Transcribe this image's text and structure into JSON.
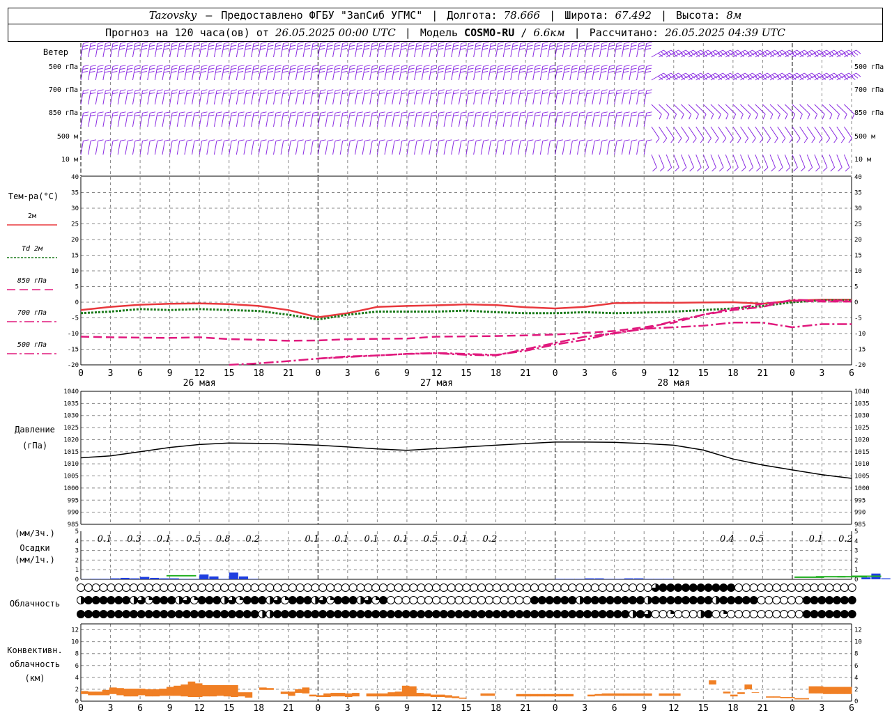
{
  "header": {
    "station": "Tazovsky",
    "source": "Предоставлено ФГБУ \"ЗапСиб УГМС\"",
    "lon_label": "Долгота:",
    "lon_value": "78.666",
    "lat_label": "Широта:",
    "lat_value": "67.492",
    "alt_label": "Высота:",
    "alt_value": "8м",
    "forecast_prefix": "Прогноз на 120 часа(ов) от",
    "forecast_start": "26.05.2025 00:00 UTC",
    "model_label": "Модель",
    "model_name": "COSMO-RU",
    "model_res": "6.6км",
    "computed_label": "Рассчитано:",
    "computed_value": "26.05.2025 04:39 UTC"
  },
  "colors": {
    "wind": "#8a2be2",
    "t2m": "#e8383d",
    "td2m": "#1a7a1a",
    "t850": "#e0197d",
    "t700": "#e0197d",
    "t500": "#e0197d",
    "pressure": "#000000",
    "precip_rain": "#1f3fe0",
    "precip_mixed": "#22b022",
    "convective": "#f07f24",
    "grid": "#888888"
  },
  "wind_panel": {
    "title": "Ветер",
    "levels": [
      "500 гПа",
      "700 гПа",
      "850 гПа",
      "500 м",
      "10 м"
    ]
  },
  "time_axis": {
    "hour_labels": [
      "0",
      "3",
      "6",
      "9",
      "12",
      "15",
      "18",
      "21",
      "0",
      "3",
      "6",
      "9",
      "12",
      "15",
      "18",
      "21",
      "0",
      "3",
      "6",
      "9",
      "12",
      "15",
      "18",
      "21",
      "0",
      "3",
      "6"
    ],
    "day_labels": [
      "26 мая",
      "27 мая",
      "28 мая"
    ]
  },
  "chart_data": [
    {
      "type": "line",
      "ylabel": "Тем-ра(°C)",
      "ylim": [
        -20,
        40
      ],
      "yticks": [
        "40",
        "35",
        "30",
        "25",
        "20",
        "15",
        "10",
        "5",
        "0",
        "-5",
        "-10",
        "-15",
        "-20"
      ],
      "x_hours_step": 3,
      "series": [
        {
          "name": "2м",
          "style": "solid",
          "values": [
            -2.5,
            -1.5,
            -0.8,
            -0.5,
            -0.4,
            -0.6,
            -1.2,
            -2.5,
            -4.8,
            -3.5,
            -1.5,
            -1.2,
            -1.0,
            -0.7,
            -0.9,
            -1.6,
            -2.0,
            -1.5,
            -0.3,
            -0.2,
            -0.2,
            -0.1,
            0.0,
            -0.5,
            0.5,
            0.8,
            0.8
          ]
        },
        {
          "name": "Td 2м",
          "style": "dotted",
          "values": [
            -3.5,
            -3.0,
            -2.2,
            -2.5,
            -2.2,
            -2.5,
            -2.8,
            -4.0,
            -5.5,
            -4.0,
            -3.0,
            -3.0,
            -3.0,
            -2.7,
            -3.2,
            -3.5,
            -3.5,
            -3.2,
            -3.5,
            -3.3,
            -3.0,
            -2.5,
            -2.0,
            -1.2,
            0.0,
            0.6,
            0.6
          ]
        },
        {
          "name": "850 гПа",
          "style": "dashed",
          "values": [
            -11.0,
            -11.2,
            -11.3,
            -11.4,
            -11.2,
            -11.8,
            -12.0,
            -12.3,
            -12.2,
            -11.8,
            -11.7,
            -11.6,
            -11.0,
            -10.9,
            -10.8,
            -10.6,
            -10.3,
            -9.8,
            -9.2,
            -8.0,
            -6.5,
            -4.0,
            -2.0,
            -0.5,
            0.5,
            0.2,
            0.2
          ]
        },
        {
          "name": "700 гПа",
          "style": "dashdot",
          "values": [
            null,
            null,
            null,
            null,
            null,
            null,
            null,
            null,
            -18.0,
            -17.3,
            -17.0,
            -16.5,
            -16.3,
            -16.8,
            -17.0,
            -15.0,
            -13.0,
            -11.0,
            -10.0,
            -8.5,
            -8.0,
            -7.5,
            -6.5,
            -6.5,
            -8.0,
            -7.0,
            -7.0
          ]
        },
        {
          "name": "500 гПа",
          "style": "dashdot",
          "values": [
            null,
            null,
            null,
            null,
            null,
            -20.0,
            -19.5,
            -18.8,
            -18.0,
            -17.5,
            -17.0,
            -16.5,
            -16.2,
            -16.5,
            -16.8,
            -15.5,
            -13.5,
            -12.0,
            -9.8,
            -8.5,
            -6.0,
            -4.0,
            -2.5,
            -1.5,
            0.8,
            0.5,
            0.5
          ]
        }
      ]
    },
    {
      "type": "line",
      "ylabel": "Давление",
      "yunit": "(гПа)",
      "ylim": [
        985,
        1040
      ],
      "yticks": [
        "1040",
        "1035",
        "1030",
        "1025",
        "1020",
        "1015",
        "1010",
        "1005",
        "1000",
        "995",
        "990",
        "985"
      ],
      "series": [
        {
          "name": "Давление",
          "values": [
            1012.5,
            1013.3,
            1015.0,
            1016.8,
            1018.0,
            1018.6,
            1018.5,
            1018.2,
            1017.7,
            1017.0,
            1016.2,
            1015.6,
            1016.3,
            1017.0,
            1017.7,
            1018.4,
            1019.0,
            1019.0,
            1018.9,
            1018.4,
            1017.7,
            1015.7,
            1012.0,
            1009.5,
            1007.5,
            1005.5,
            1004.0
          ]
        }
      ]
    },
    {
      "type": "bar",
      "ylabel": "Осадки",
      "yunit_top": "(мм/3ч.)",
      "yunit_bottom": "(мм/1ч.)",
      "ylim": [
        0,
        5
      ],
      "yticks": [
        "5",
        "4",
        "3",
        "2",
        "1",
        "0"
      ],
      "totals_3h": [
        {
          "hour_index": 0.3,
          "value": "0.1"
        },
        {
          "hour_index": 1.3,
          "value": "0.3"
        },
        {
          "hour_index": 2.3,
          "value": "0.1"
        },
        {
          "hour_index": 3.3,
          "value": "0.5"
        },
        {
          "hour_index": 4.3,
          "value": "0.8"
        },
        {
          "hour_index": 5.3,
          "value": "0.2"
        },
        {
          "hour_index": 7.3,
          "value": "0.1"
        },
        {
          "hour_index": 8.3,
          "value": "0.1"
        },
        {
          "hour_index": 9.3,
          "value": "0.1"
        },
        {
          "hour_index": 10.3,
          "value": "0.1"
        },
        {
          "hour_index": 11.3,
          "value": "0.5"
        },
        {
          "hour_index": 12.3,
          "value": "0.1"
        },
        {
          "hour_index": 13.3,
          "value": "0.2"
        },
        {
          "hour_index": 21.3,
          "value": "0.4"
        },
        {
          "hour_index": 22.3,
          "value": "0.5"
        },
        {
          "hour_index": 24.3,
          "value": "0.1"
        },
        {
          "hour_index": 25.3,
          "value": "0.2"
        }
      ],
      "hourly_mm": [
        0.02,
        0.05,
        0.05,
        0.1,
        0.15,
        0.1,
        0.25,
        0.15,
        0.1,
        0.1,
        0.05,
        0.05,
        0.5,
        0.3,
        0.05,
        0.7,
        0.3,
        0.05,
        0.0,
        0.0,
        0.0,
        0.0,
        0.0,
        0.0,
        0.05,
        0.05,
        0.05,
        0.1,
        0.1,
        0.05,
        0.05,
        0.1,
        0.1,
        0.05,
        0.05,
        0.05,
        0.0,
        0.2,
        0.6,
        0.1,
        0.05,
        0.0,
        0.05,
        0.1,
        0.1,
        0.05,
        0.0,
        0.0
      ],
      "mixed_bars": [
        {
          "hour": 12,
          "value": 0.3
        },
        {
          "hour": 100,
          "value": 0.15
        },
        {
          "hour": 103,
          "value": 0.2
        },
        {
          "hour": 106,
          "value": 0.2
        },
        {
          "hour": 108,
          "value": 0.25
        }
      ]
    },
    {
      "type": "table",
      "ylabel": "Облачность",
      "rows": [
        "000000000000000000000000000000000000000000000000000000000000000000000000000000000000000000000000000000000000000000000000",
        "244444434442444244424222224444424432100000000000000000000000000000002442444444444444444444440000444444",
        "444444444444444444444444444444444444444444444444444444444444444444444424444432400000000002400000444444444444"
      ],
      "row_top_special": {
        "cols": [
          76,
          77,
          78,
          79,
          80,
          81,
          82,
          83,
          84,
          85,
          86
        ],
        "values": [
          3,
          4,
          4,
          4,
          4,
          4,
          4,
          4,
          4,
          4,
          4
        ],
        "start": 76
      }
    },
    {
      "type": "bar",
      "ylabel": "Конвективн. облачность (км)",
      "ylim": [
        0,
        13
      ],
      "yticks": [
        "12",
        "10",
        "8",
        "6",
        "4",
        "2",
        "0"
      ],
      "ranges_km": [
        [
          1.2,
          1.7
        ],
        [
          1.0,
          1.6
        ],
        [
          1.0,
          1.6
        ],
        [
          1.0,
          1.9
        ],
        [
          1.2,
          2.3
        ],
        [
          1.0,
          2.2
        ],
        [
          0.8,
          2.1
        ],
        [
          0.8,
          2.1
        ],
        [
          1.0,
          2.1
        ],
        [
          0.8,
          2.0
        ],
        [
          0.8,
          2.0
        ],
        [
          0.9,
          2.1
        ],
        [
          0.9,
          2.4
        ],
        [
          0.9,
          2.6
        ],
        [
          0.8,
          2.8
        ],
        [
          0.7,
          3.3
        ],
        [
          0.7,
          3.0
        ],
        [
          0.8,
          2.7
        ],
        [
          0.8,
          2.7
        ],
        [
          0.9,
          2.7
        ],
        [
          0.8,
          2.7
        ],
        [
          0.7,
          2.7
        ],
        [
          0.8,
          1.5
        ],
        [
          0.6,
          1.5
        ],
        [
          null,
          null
        ],
        [
          1.9,
          2.3
        ],
        [
          1.9,
          2.2
        ],
        [
          null,
          null
        ],
        [
          1.2,
          1.6
        ],
        [
          0.9,
          1.6
        ],
        [
          1.4,
          2.0
        ],
        [
          1.3,
          2.3
        ],
        [
          0.8,
          1.1
        ],
        [
          0.7,
          1.0
        ],
        [
          0.7,
          1.3
        ],
        [
          0.8,
          1.4
        ],
        [
          0.8,
          1.4
        ],
        [
          0.7,
          1.3
        ],
        [
          0.8,
          1.4
        ],
        [
          null,
          null
        ],
        [
          0.8,
          1.3
        ],
        [
          0.8,
          1.3
        ],
        [
          0.8,
          1.3
        ],
        [
          0.8,
          1.5
        ],
        [
          0.8,
          1.6
        ],
        [
          0.8,
          2.6
        ],
        [
          0.8,
          2.5
        ],
        [
          0.8,
          1.4
        ],
        [
          0.8,
          1.3
        ],
        [
          0.7,
          1.1
        ],
        [
          0.7,
          1.1
        ],
        [
          0.6,
          1.0
        ],
        [
          0.5,
          0.8
        ],
        [
          0.4,
          0.6
        ],
        [
          null,
          null
        ],
        [
          null,
          null
        ],
        [
          0.9,
          1.3
        ],
        [
          0.9,
          1.3
        ],
        [
          null,
          null
        ],
        [
          null,
          null
        ],
        [
          null,
          null
        ],
        [
          0.8,
          1.2
        ],
        [
          0.8,
          1.2
        ],
        [
          0.8,
          1.2
        ],
        [
          0.8,
          1.2
        ],
        [
          0.8,
          1.2
        ],
        [
          0.8,
          1.2
        ],
        [
          0.8,
          1.2
        ],
        [
          0.8,
          1.2
        ],
        [
          null,
          null
        ],
        [
          null,
          null
        ],
        [
          0.8,
          1.1
        ],
        [
          0.9,
          1.2
        ],
        [
          0.9,
          1.3
        ],
        [
          0.9,
          1.3
        ],
        [
          0.9,
          1.3
        ],
        [
          0.9,
          1.3
        ],
        [
          0.9,
          1.3
        ],
        [
          0.9,
          1.3
        ],
        [
          0.9,
          1.3
        ],
        [
          null,
          null
        ],
        [
          0.9,
          1.3
        ],
        [
          0.9,
          1.3
        ],
        [
          0.9,
          1.3
        ],
        [
          null,
          null
        ],
        [
          null,
          null
        ],
        [
          null,
          null
        ],
        [
          null,
          null
        ],
        [
          2.8,
          3.5
        ],
        [
          null,
          null
        ],
        [
          1.3,
          1.6
        ],
        [
          0.8,
          1.1
        ],
        [
          1.2,
          1.5
        ],
        [
          2.0,
          2.8
        ],
        [
          1.4,
          1.5
        ],
        [
          null,
          null
        ],
        [
          0.6,
          0.8
        ],
        [
          0.6,
          0.8
        ],
        [
          0.5,
          0.7
        ],
        [
          0.5,
          0.7
        ],
        [
          0.3,
          0.5
        ],
        [
          0.3,
          0.5
        ],
        [
          1.3,
          2.5
        ],
        [
          1.3,
          2.5
        ],
        [
          1.2,
          2.4
        ],
        [
          1.2,
          2.4
        ],
        [
          1.2,
          2.4
        ],
        [
          1.2,
          2.4
        ]
      ]
    }
  ]
}
